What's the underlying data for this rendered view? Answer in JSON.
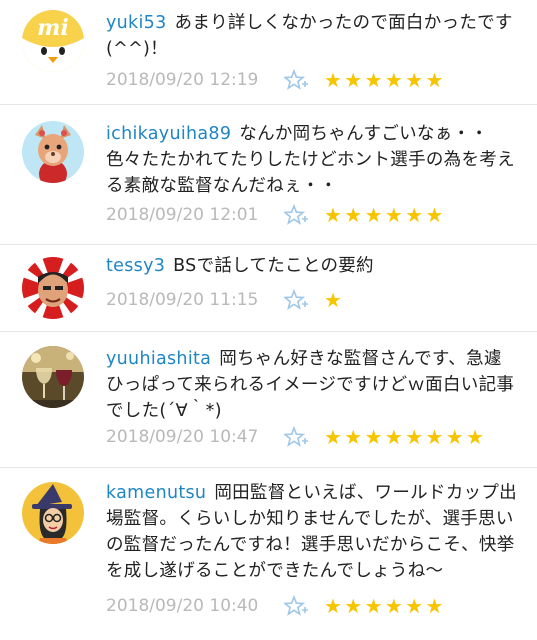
{
  "comments": [
    {
      "username": "yuki53",
      "text": "あまり詳しくなかったので面白かったです(^^)！",
      "timestamp": "2018/09/20 12:19",
      "stars": 6,
      "avatar": "mi-chick-avatar"
    },
    {
      "username": "ichikayuiha89",
      "text": "なんか岡ちゃんすごいなぁ・・色々たたかれてたりしたけどホント選手の為を考える素敵な監督なんだねぇ・・",
      "timestamp": "2018/09/20 12:01",
      "stars": 6,
      "avatar": "pink-bear-avatar"
    },
    {
      "username": "tessy3",
      "text": "BSで話してたことの要約",
      "timestamp": "2018/09/20 11:15",
      "stars": 1,
      "avatar": "man-rising-sun-avatar"
    },
    {
      "username": "yuuhiashita",
      "text": "岡ちゃん好きな監督さんです、急遽ひっぱって来られるイメージですけどｗ面白い記事でした(´∀｀*)",
      "timestamp": "2018/09/20 10:47",
      "stars": 8,
      "avatar": "wine-glasses-avatar"
    },
    {
      "username": "kamenutsu",
      "text": "岡田監督といえば、ワールドカップ出場監督。くらいしか知りませんでしたが、選手思いの監督だったんですね！選手思いだからこそ、快挙を成し遂げることができたんでしょうね〜",
      "timestamp": "2018/09/20 10:40",
      "stars": 6,
      "avatar": "witch-avatar"
    }
  ],
  "colors": {
    "username": "#1f86c6",
    "timestamp": "#b9b9b9",
    "star": "#f7c500",
    "fav_icon": "#9fc7e8"
  }
}
